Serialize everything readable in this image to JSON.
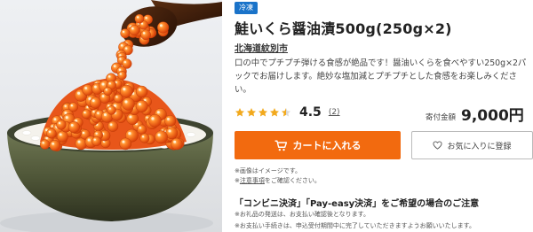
{
  "product": {
    "badge": "冷凍",
    "title": "鮭いくら醤油漬500g(250g×2)",
    "seller": "北海道紋別市",
    "description": "口の中でプチプチ弾ける食感が絶品です！醤油いくらを食べやすい250g×2パックでお届けします。絶妙な塩加減とプチプチとした食感をお楽しみください。",
    "image_icon": "ikura-rice-bowl-photo"
  },
  "rating": {
    "value": "4.5",
    "review_count": "(2)",
    "stars": 4.5,
    "star_color": "#f2a91d"
  },
  "price": {
    "label": "寄付金額",
    "value": "9,000円"
  },
  "buttons": {
    "cart_label": "カートに入れる",
    "cart_icon": "cart-icon",
    "cart_color": "#f26a0f",
    "favorite_label": "お気に入りに登録",
    "favorite_icon": "heart-icon"
  },
  "notes": {
    "image_note": "※画像はイメージです。",
    "caution_prefix": "※",
    "caution_link": "注意事項",
    "caution_suffix": "をご確認ください。"
  },
  "payment_notice": {
    "title": "「コンビニ決済」「Pay-easy決済」をご希望の場合のご注意",
    "line1": "※お礼品の発送は、お支払い確認後となります。",
    "line2": "※お支払い手続きは、申込受付期間中に完了していただきますようお願いいたします。"
  }
}
